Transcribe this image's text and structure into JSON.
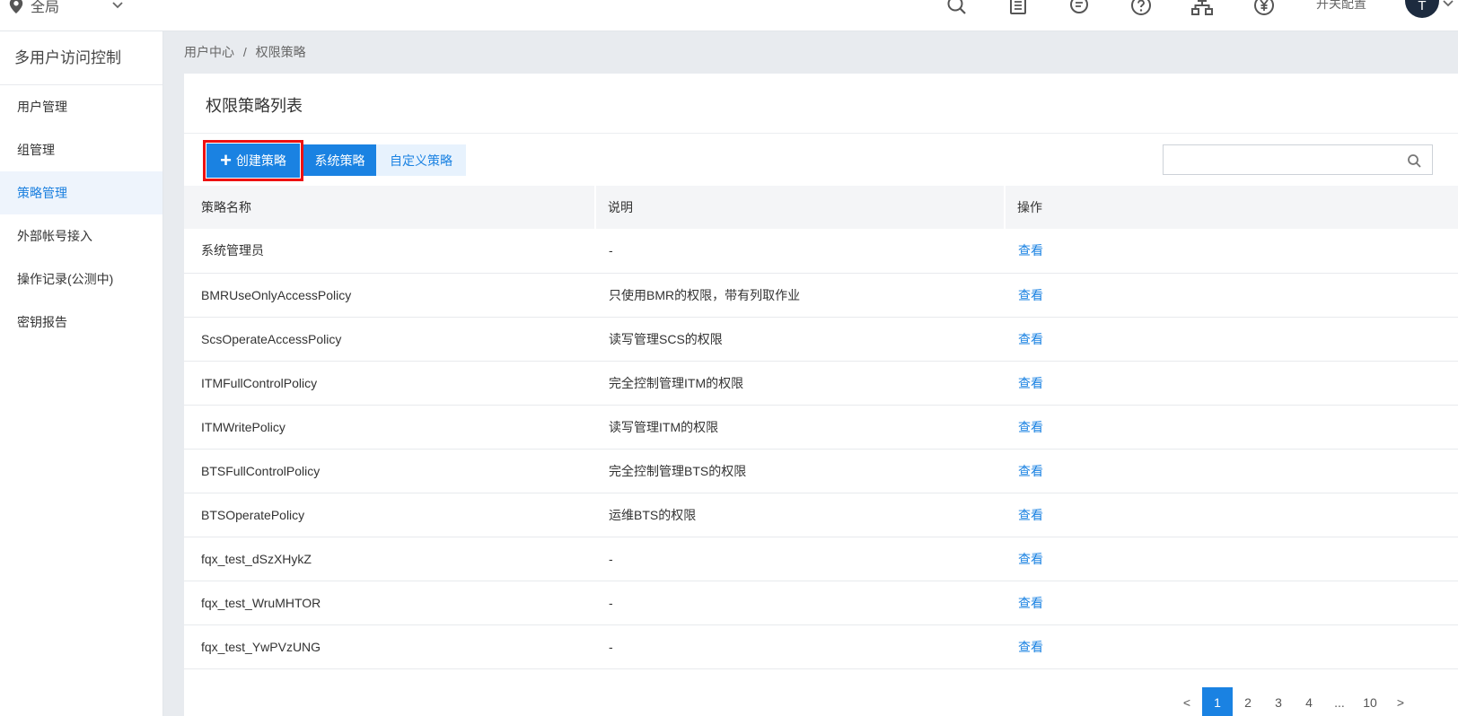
{
  "topbar": {
    "region": "全局",
    "switch_config": "开关配置",
    "avatar_initial": "T",
    "icons": [
      "search-icon",
      "document-icon",
      "message-icon",
      "help-icon",
      "org-icon",
      "yuan-icon"
    ]
  },
  "sidebar": {
    "title": "多用户访问控制",
    "items": [
      {
        "label": "用户管理"
      },
      {
        "label": "组管理"
      },
      {
        "label": "策略管理"
      },
      {
        "label": "外部帐号接入"
      },
      {
        "label": "操作记录(公测中)"
      },
      {
        "label": "密钥报告"
      }
    ],
    "active_index": 2
  },
  "breadcrumb": {
    "home": "用户中心",
    "sep": "/",
    "current": "权限策略"
  },
  "card": {
    "title": "权限策略列表",
    "create_label": "创建策略",
    "create_icon": "+",
    "tab_system": "系统策略",
    "tab_custom": "自定义策略",
    "search_placeholder": ""
  },
  "table": {
    "headers": [
      "策略名称",
      "说明",
      "操作"
    ],
    "rows": [
      {
        "name": "系统管理员",
        "desc": "-",
        "action": "查看"
      },
      {
        "name": "BMRUseOnlyAccessPolicy",
        "desc": "只使用BMR的权限，带有列取作业",
        "action": "查看"
      },
      {
        "name": "ScsOperateAccessPolicy",
        "desc": "读写管理SCS的权限",
        "action": "查看"
      },
      {
        "name": "ITMFullControlPolicy",
        "desc": "完全控制管理ITM的权限",
        "action": "查看"
      },
      {
        "name": "ITMWritePolicy",
        "desc": "读写管理ITM的权限",
        "action": "查看"
      },
      {
        "name": "BTSFullControlPolicy",
        "desc": "完全控制管理BTS的权限",
        "action": "查看"
      },
      {
        "name": "BTSOperatePolicy",
        "desc": "运维BTS的权限",
        "action": "查看"
      },
      {
        "name": "fqx_test_dSzXHykZ",
        "desc": "-",
        "action": "查看"
      },
      {
        "name": "fqx_test_WruMHTOR",
        "desc": "-",
        "action": "查看"
      },
      {
        "name": "fqx_test_YwPVzUNG",
        "desc": "-",
        "action": "查看"
      }
    ]
  },
  "pagination": {
    "prev": "<",
    "pages": [
      "1",
      "2",
      "3",
      "4",
      "...",
      "10"
    ],
    "next": ">",
    "current": "1"
  },
  "colors": {
    "accent": "#1a82e2",
    "highlight": "#e11111",
    "sidebar_active_bg": "#eef4fc"
  }
}
